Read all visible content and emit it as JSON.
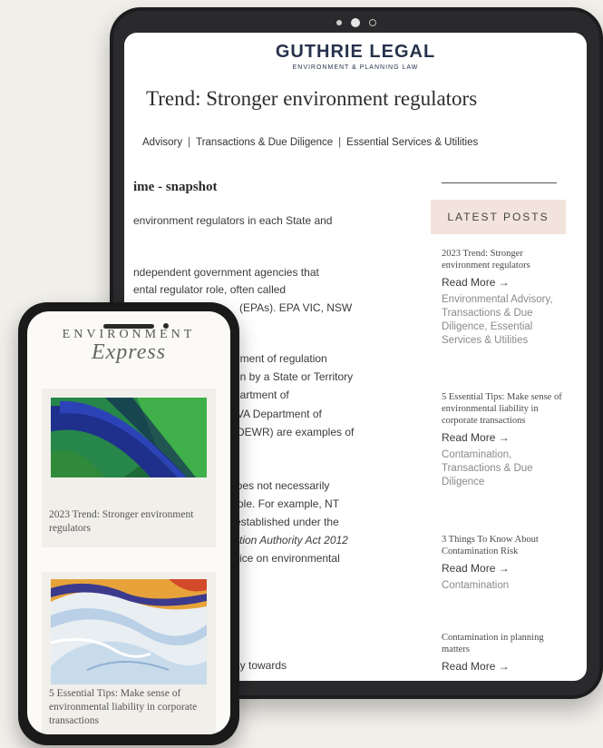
{
  "tablet": {
    "brand": {
      "name": "GUTHRIE LEGAL",
      "subtitle": "ENVIRONMENT & PLANNING LAW"
    },
    "post_title": "Trend: Stronger environment regulators",
    "categories": [
      "Advisory",
      "Transactions & Due Diligence",
      "Essential Services & Utilities"
    ],
    "separator": "|",
    "section_heading": "ime - snapshot",
    "article_lines": [
      "environment regulators in each State and",
      "ndependent government agencies that",
      "ental regulator role, often called",
      "(EPAs). EPA VIC, NSW",
      "ement of regulation",
      "en by a State or Territory",
      "partment of",
      "VA Department of",
      "(DEWR) are examples of",
      "loes not necessarily",
      "role.  For example, NT",
      "established under the",
      "ction Authority Act 2012",
      "vice on environmental",
      "ay towards"
    ],
    "sidebar": {
      "heading": "LATEST POSTS",
      "posts": [
        {
          "title": "2023 Trend: Stronger environment regulators",
          "read_more": "Read More →",
          "categories": "Environmental Advisory, Transactions & Due Diligence, Essential Services & Utilities"
        },
        {
          "title": "5 Essential Tips: Make sense of environmental liability in corporate transactions",
          "read_more": "Read More →",
          "categories": "Contamination, Transactions & Due Diligence"
        },
        {
          "title": "3 Things To Know About Contamination Risk",
          "read_more": "Read More →",
          "categories": "Contamination"
        },
        {
          "title": "Contamination in planning matters",
          "read_more": "Read More →",
          "categories": ""
        }
      ]
    }
  },
  "phone": {
    "logo_top": "ENVIRONMENT",
    "logo_script": "Express",
    "cards": [
      {
        "title": "2023 Trend: Stronger environment regulators"
      },
      {
        "title": "5 Essential Tips: Make sense of environmental liability in corporate transactions"
      }
    ]
  }
}
